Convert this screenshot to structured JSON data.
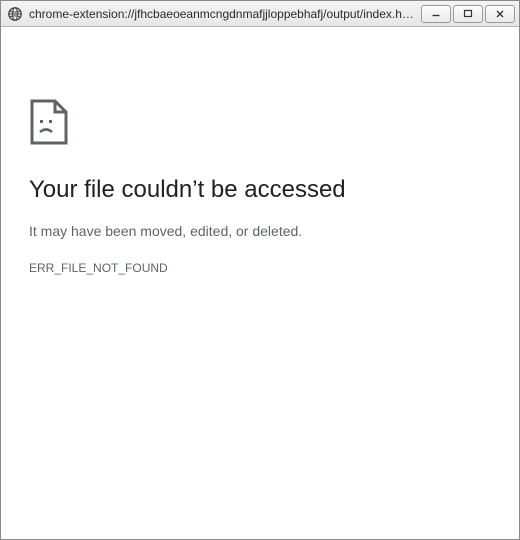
{
  "window": {
    "title": "chrome-extension://jfhcbaeoeanmcngdnmafjjloppebhafj/output/index.html"
  },
  "error": {
    "heading": "Your file couldn’t be accessed",
    "subtext": "It may have been moved, edited, or deleted.",
    "code": "ERR_FILE_NOT_FOUND"
  }
}
